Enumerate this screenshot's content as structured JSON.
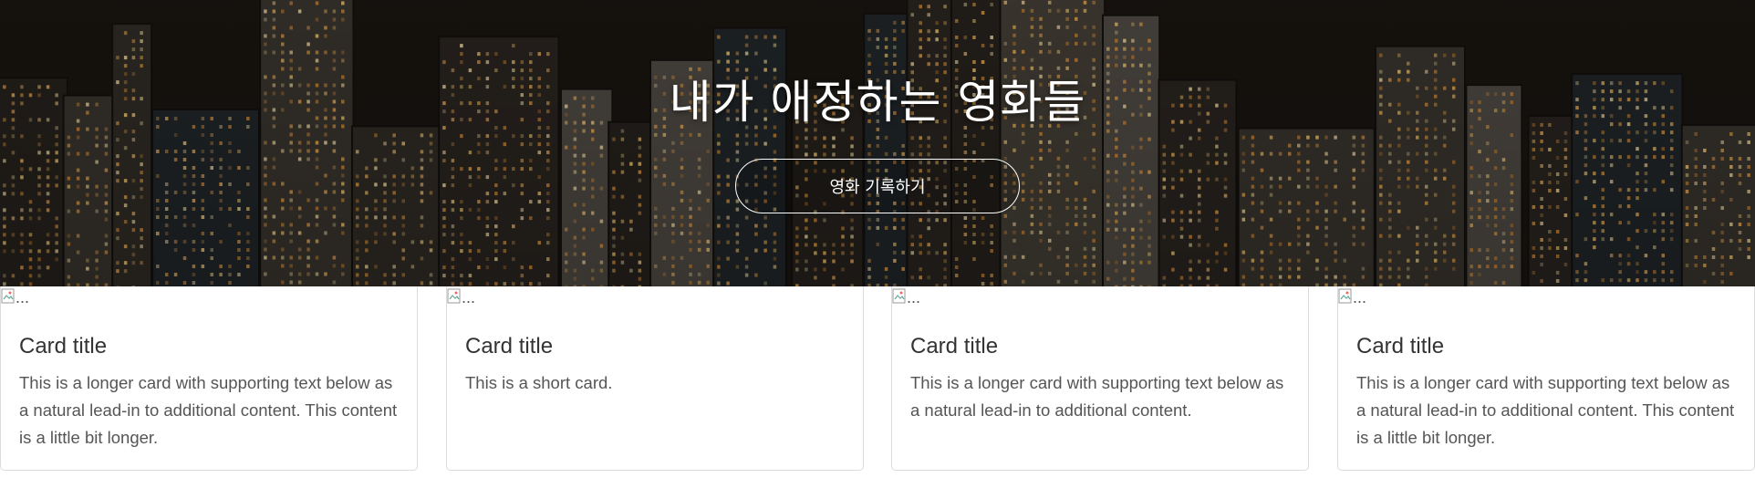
{
  "hero": {
    "title": "내가 애정하는 영화들",
    "button_label": "영화 기록하기"
  },
  "cards": [
    {
      "img_alt": "...",
      "title": "Card title",
      "text": "This is a longer card with supporting text below as a natural lead-in to additional content. This content is a little bit longer."
    },
    {
      "img_alt": "...",
      "title": "Card title",
      "text": "This is a short card."
    },
    {
      "img_alt": "...",
      "title": "Card title",
      "text": "This is a longer card with supporting text below as a natural lead-in to additional content."
    },
    {
      "img_alt": "...",
      "title": "Card title",
      "text": "This is a longer card with supporting text below as a natural lead-in to additional content. This content is a little bit longer."
    }
  ]
}
